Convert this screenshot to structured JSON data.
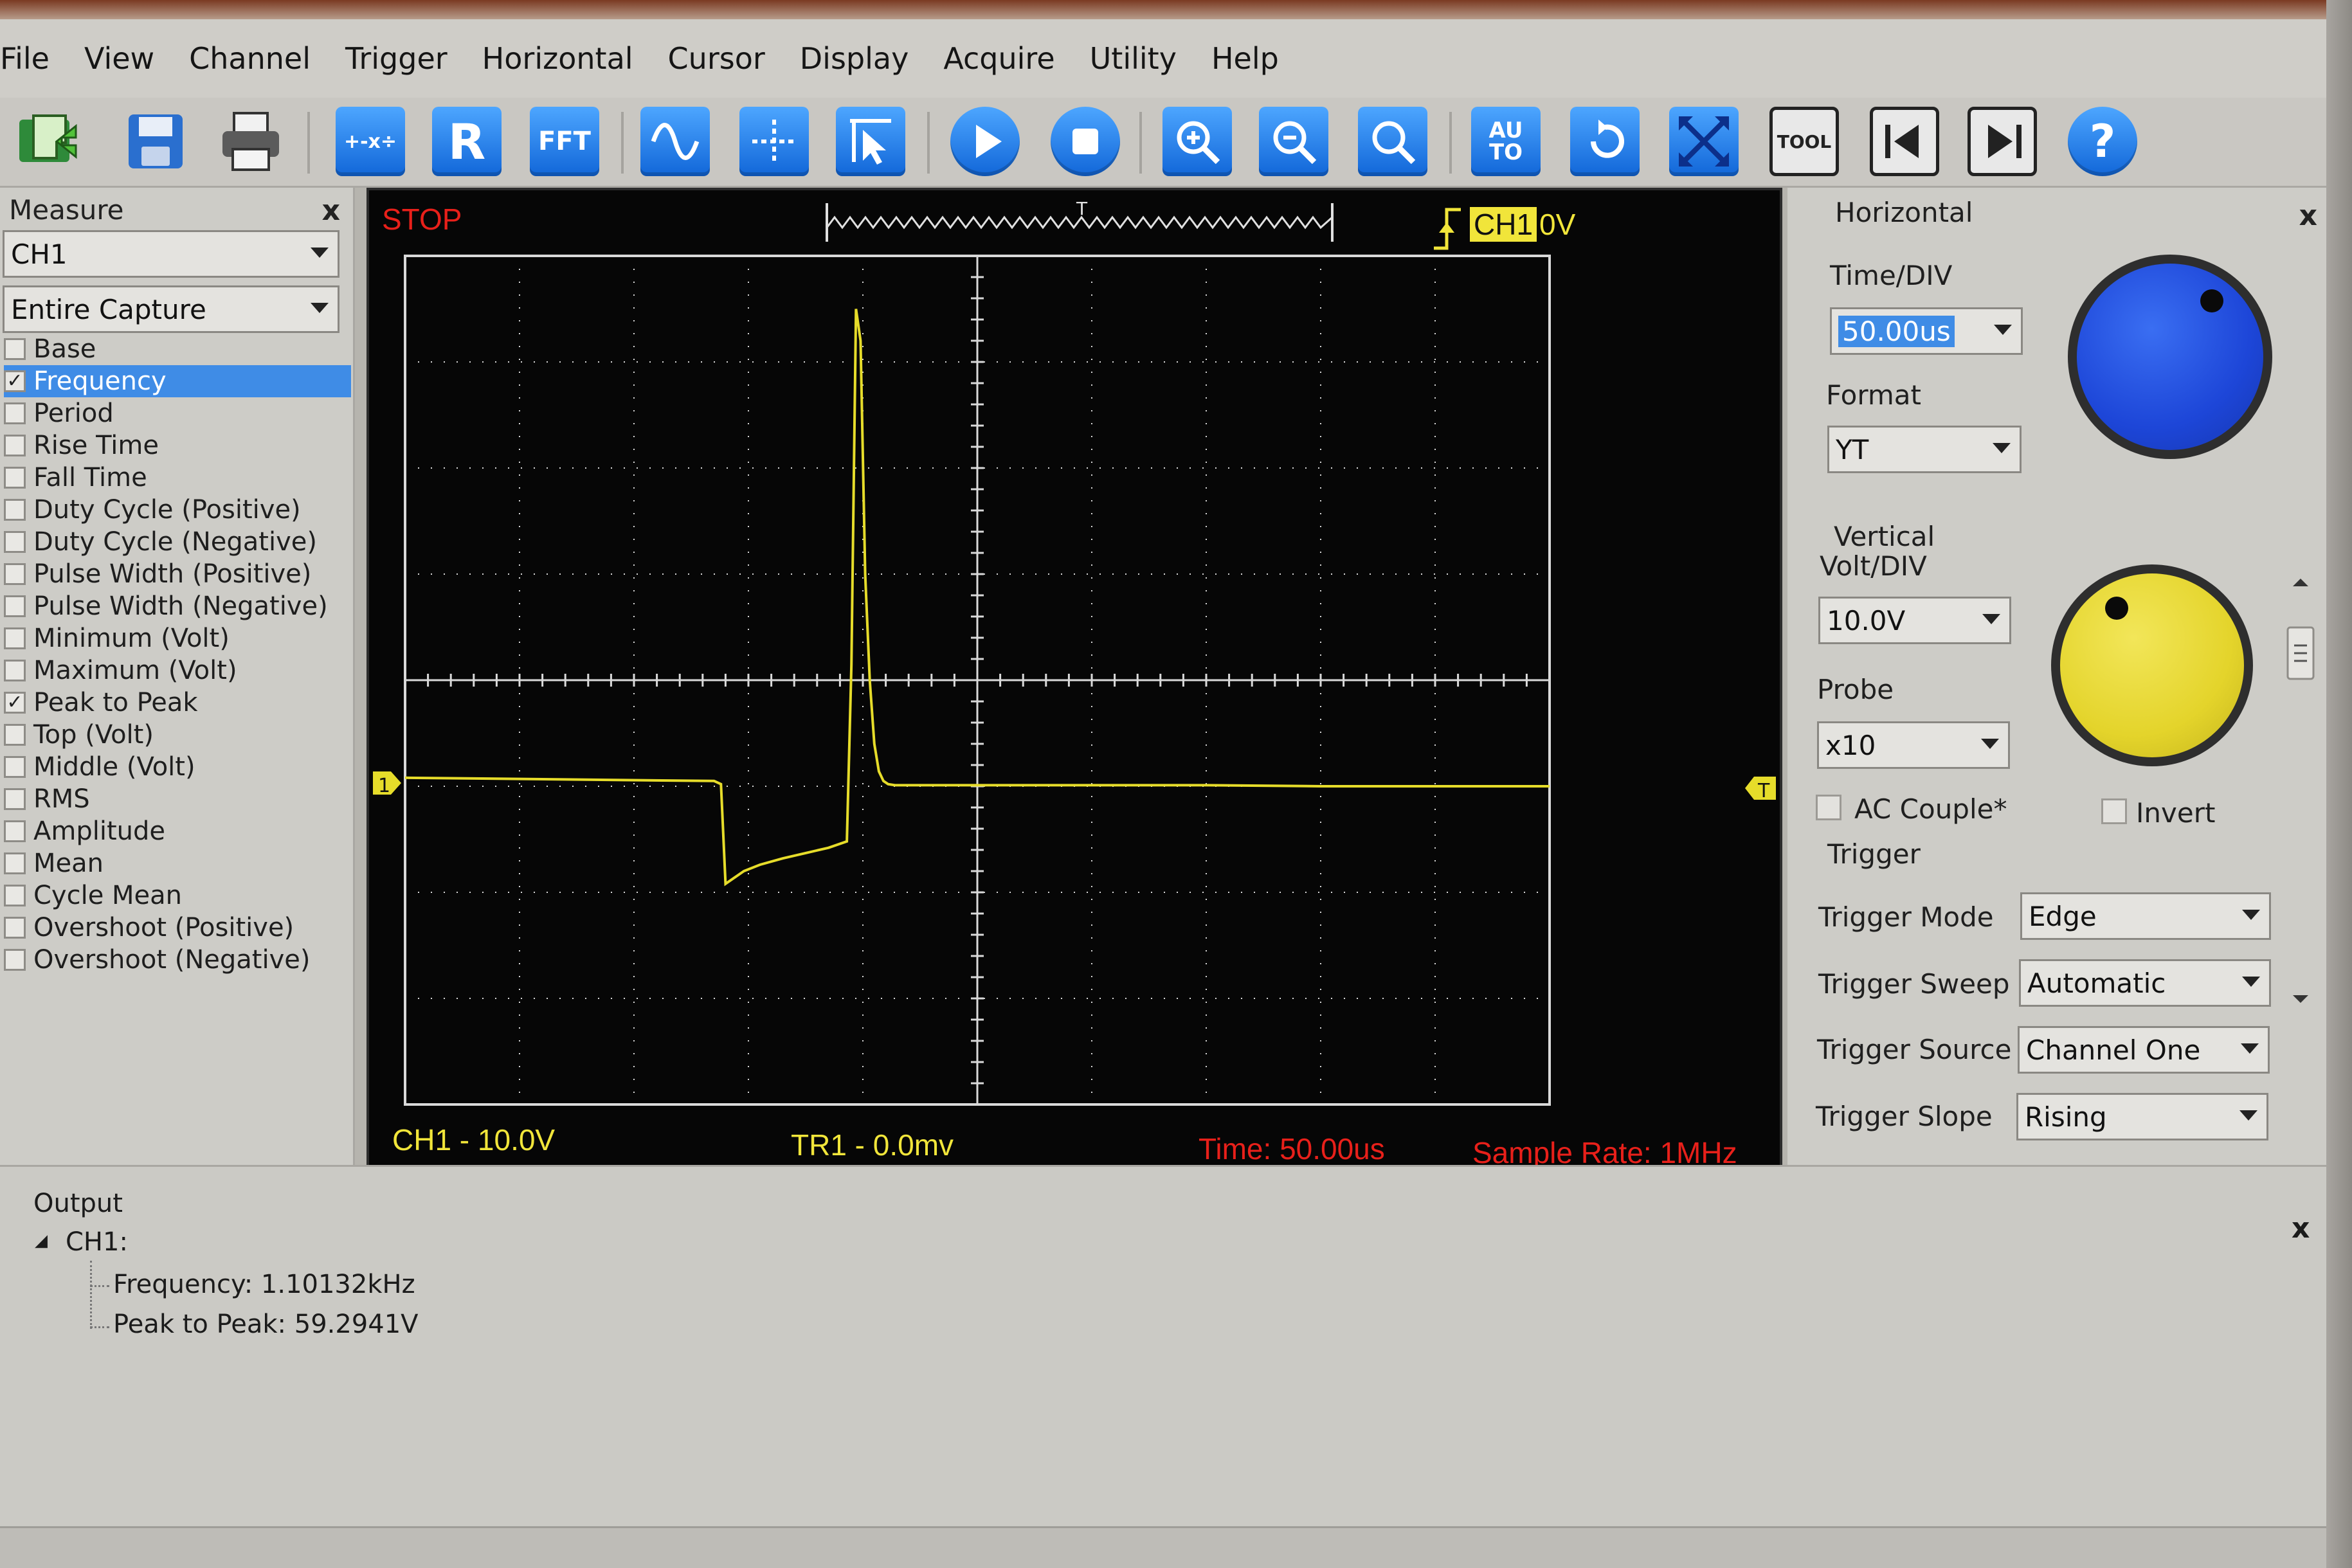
{
  "menu": [
    "File",
    "View",
    "Channel",
    "Trigger",
    "Horizontal",
    "Cursor",
    "Display",
    "Acquire",
    "Utility",
    "Help"
  ],
  "toolbar": {
    "items": [
      {
        "name": "open-icon",
        "label": ""
      },
      {
        "name": "save-icon",
        "label": ""
      },
      {
        "name": "print-icon",
        "label": ""
      },
      {
        "name": "math-icon",
        "label": "+-x÷"
      },
      {
        "name": "reference-icon",
        "label": "R"
      },
      {
        "name": "fft-icon",
        "label": "FFT"
      },
      {
        "name": "waveform-icon",
        "label": ""
      },
      {
        "name": "cursor-icon",
        "label": ""
      },
      {
        "name": "pointer-icon",
        "label": ""
      },
      {
        "name": "run-icon",
        "label": ""
      },
      {
        "name": "stop-icon",
        "label": ""
      },
      {
        "name": "zoom-in-icon",
        "label": ""
      },
      {
        "name": "zoom-out-icon",
        "label": ""
      },
      {
        "name": "zoom-icon",
        "label": ""
      },
      {
        "name": "autoset-icon",
        "label": "AU TO"
      },
      {
        "name": "undo-icon",
        "label": ""
      },
      {
        "name": "fullscreen-icon",
        "label": ""
      },
      {
        "name": "tool-icon",
        "label": "TOOL"
      },
      {
        "name": "previous-frame-icon",
        "label": ""
      },
      {
        "name": "next-frame-icon",
        "label": ""
      },
      {
        "name": "help-icon",
        "label": "?"
      }
    ]
  },
  "measure": {
    "title": "Measure",
    "close": "x",
    "channel": "CH1",
    "range": "Entire Capture",
    "items": [
      {
        "label": "Base",
        "checked": false
      },
      {
        "label": "Frequency",
        "checked": true,
        "selected": true
      },
      {
        "label": "Period",
        "checked": false
      },
      {
        "label": "Rise Time",
        "checked": false
      },
      {
        "label": "Fall Time",
        "checked": false
      },
      {
        "label": "Duty Cycle (Positive)",
        "checked": false
      },
      {
        "label": "Duty Cycle (Negative)",
        "checked": false
      },
      {
        "label": "Pulse Width (Positive)",
        "checked": false
      },
      {
        "label": "Pulse Width (Negative)",
        "checked": false
      },
      {
        "label": "Minimum (Volt)",
        "checked": false
      },
      {
        "label": "Maximum (Volt)",
        "checked": false
      },
      {
        "label": "Peak to Peak",
        "checked": true
      },
      {
        "label": "Top (Volt)",
        "checked": false
      },
      {
        "label": "Middle (Volt)",
        "checked": false
      },
      {
        "label": "RMS",
        "checked": false
      },
      {
        "label": "Amplitude",
        "checked": false
      },
      {
        "label": "Mean",
        "checked": false
      },
      {
        "label": "Cycle Mean",
        "checked": false
      },
      {
        "label": "Overshoot (Positive)",
        "checked": false
      },
      {
        "label": "Overshoot (Negative)",
        "checked": false
      }
    ]
  },
  "scope": {
    "status": "STOP",
    "trigger_channel": "CH1",
    "trigger_level": "0V",
    "trigger_pos_marker": "T",
    "channel_marker": "1",
    "trigger_marker": "T",
    "ch1_scale": "CH1 - 10.0V",
    "tr1": "TR1 - 0.0mv",
    "time": "Time: 50.00us",
    "sample_rate": "Sample Rate: 1MHz",
    "colors": {
      "trace": "#e6dc2a",
      "status": "#e8201a",
      "grid": "#d9d9d9",
      "info": "#f1e53a"
    }
  },
  "chart_data": {
    "type": "line",
    "title": "",
    "xlabel": "",
    "ylabel": "",
    "x_unit": "us",
    "y_unit": "V",
    "xlim": [
      -250,
      250
    ],
    "ylim": [
      -40,
      40
    ],
    "grid": true,
    "series": [
      {
        "color": "#e6dc2a",
        "x": [
          -250,
          -115,
          -112,
          -110,
          -102,
          -95,
          -85,
          -75,
          -65,
          -57,
          -55,
          -53,
          -51,
          -49,
          -47,
          -45,
          -43,
          -41,
          -39,
          -36,
          -30,
          -20,
          -10,
          0,
          50,
          100,
          150,
          200,
          250
        ],
        "y": [
          -9.2,
          -9.5,
          -9.8,
          -19.2,
          -18.0,
          -17.4,
          -16.8,
          -16.3,
          -15.8,
          -15.2,
          1.5,
          35.0,
          32.0,
          10.0,
          0.0,
          -6.0,
          -8.6,
          -9.5,
          -9.8,
          -9.9,
          -9.9,
          -9.9,
          -9.9,
          -9.9,
          -9.9,
          -9.9,
          -10.0,
          -10.0,
          -10.0
        ]
      }
    ]
  },
  "horizontal": {
    "title": "Horizontal",
    "close": "x",
    "time_div_label": "Time/DIV",
    "time_div": "50.00us",
    "format_label": "Format",
    "format": "YT",
    "knob_color": "#1d46d8"
  },
  "vertical": {
    "title": "Vertical",
    "volt_div_label": "Volt/DIV",
    "volt_div": "10.0V",
    "probe_label": "Probe",
    "probe": "x10",
    "ac_couple": "AC Couple*",
    "invert": "Invert",
    "knob_color": "#e4d42b"
  },
  "trigger": {
    "title": "Trigger",
    "mode_label": "Trigger Mode",
    "mode": "Edge",
    "sweep_label": "Trigger Sweep",
    "sweep": "Automatic",
    "source_label": "Trigger Source",
    "source": "Channel One",
    "slope_label": "Trigger Slope",
    "slope": "Rising"
  },
  "output": {
    "title": "Output",
    "close": "x",
    "channel": "CH1:",
    "lines": [
      "Frequency: 1.10132kHz",
      "Peak to Peak: 59.2941V"
    ]
  }
}
